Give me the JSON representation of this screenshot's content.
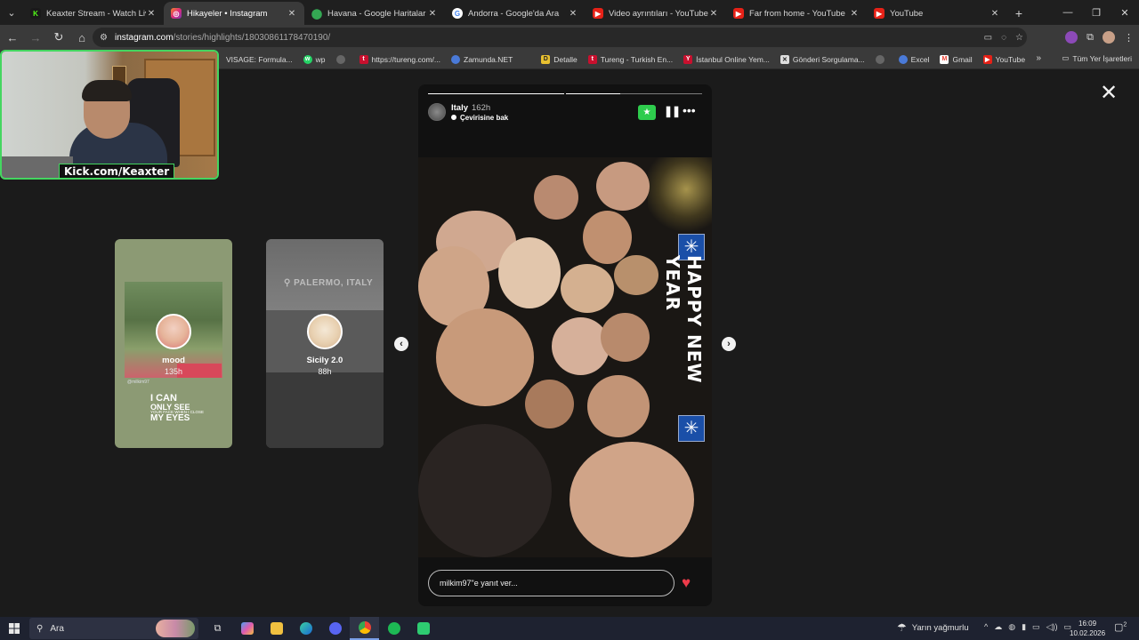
{
  "colors": {
    "accent_green": "#44d660",
    "star_green": "#2ecc4d",
    "heart_red": "#ed3b4a",
    "youtube_red": "#e62117",
    "instagram": "#d8347c"
  },
  "browser": {
    "tabs": [
      {
        "title": "Keaxter Stream - Watch Live on",
        "icon": "kick-icon",
        "color": "#53fc18",
        "active": false
      },
      {
        "title": "Hikayeler • Instagram",
        "icon": "instagram-icon",
        "color": "#d8347c",
        "active": true
      },
      {
        "title": "Havana - Google Haritalar",
        "icon": "maps-pin-icon",
        "color": "#34a853",
        "active": false
      },
      {
        "title": "Andorra - Google'da Ara",
        "icon": "google-icon",
        "color": "#ffffff",
        "active": false
      },
      {
        "title": "Video ayrıntıları - YouTube Stud",
        "icon": "youtube-icon",
        "color": "#e62117",
        "active": false
      },
      {
        "title": "Far from home - YouTube",
        "icon": "youtube-icon",
        "color": "#e62117",
        "active": false
      },
      {
        "title": "YouTube",
        "icon": "youtube-icon",
        "color": "#e62117",
        "active": false
      }
    ],
    "url_host": "instagram.com",
    "url_path": "/stories/highlights/18030861178470190/",
    "bookmarks": [
      {
        "label": "VISAGE: Formula...",
        "color": "#444444"
      },
      {
        "label": "wp",
        "color": "#25d366"
      },
      {
        "label": "",
        "color": "#888888"
      },
      {
        "label": "https://tureng.com/...",
        "color": "#c8102e"
      },
      {
        "label": "Zamunda.NET",
        "color": "#4a7ad8"
      },
      {
        "label": "Detalle",
        "color": "#e8c030"
      },
      {
        "label": "Tureng - Turkish En...",
        "color": "#c8102e"
      },
      {
        "label": "İstanbul Online Yem...",
        "color": "#c8102e"
      },
      {
        "label": "Gönderi Sorgulama...",
        "color": "#dddddd"
      },
      {
        "label": "",
        "color": "#888888"
      },
      {
        "label": "Excel",
        "color": "#4a7ad8"
      },
      {
        "label": "Gmail",
        "color": "#ea4335"
      },
      {
        "label": "YouTube",
        "color": "#e62117"
      }
    ],
    "all_bookmarks_label": "Tüm Yer İşaretleri"
  },
  "webcam": {
    "label": "Kick.com/Keaxter"
  },
  "highlights": {
    "left_card": {
      "name": "mood",
      "age": "135h",
      "handle": "@milkim97",
      "text_big": "I CAN",
      "text_big2": "ONLY SEE",
      "text_small": "YOUR FACE WHEN I CLOSE",
      "text_big3": "MY EYES"
    },
    "right_card": {
      "name": "Sicily 2.0",
      "age": "88h",
      "location": "PALERMO, ITALY"
    }
  },
  "story": {
    "name": "Italy",
    "time": "162h",
    "subtitle": "Çevirisine bak",
    "overlay_text": "HAPPY NEW YEAR",
    "reply_placeholder": "milkim97\"e yanıt ver...",
    "progress": {
      "segments_total": 2,
      "current_segment": 2,
      "current_fraction": 0.4
    }
  },
  "taskbar": {
    "search_label": "Ara",
    "weather": "Yarın yağmurlu",
    "time": "16:09",
    "date": "10.02.2026",
    "notification_count": "2"
  }
}
